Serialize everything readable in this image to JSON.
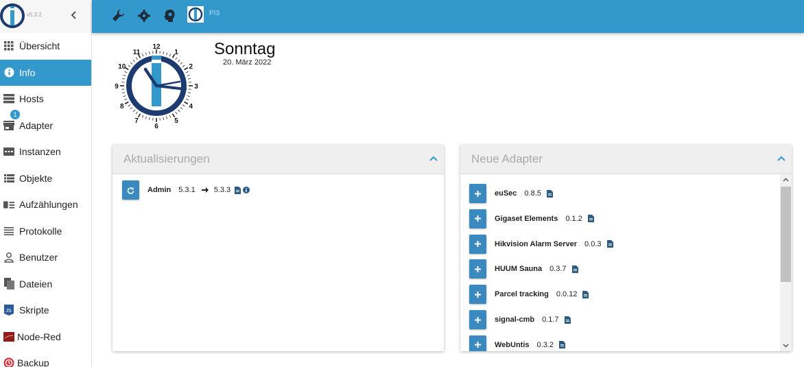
{
  "app": {
    "version": "v5.3.2",
    "host_name": "PI3"
  },
  "sidebar": {
    "items": [
      {
        "label": "Übersicht",
        "icon": "grid-icon"
      },
      {
        "label": "Info",
        "icon": "info-icon",
        "active": true
      },
      {
        "label": "Hosts",
        "icon": "hosts-icon"
      },
      {
        "label": "Adapter",
        "icon": "store-icon",
        "badge": "1"
      },
      {
        "label": "Instanzen",
        "icon": "instances-icon"
      },
      {
        "label": "Objekte",
        "icon": "list-icon"
      },
      {
        "label": "Aufzählungen",
        "icon": "enum-icon"
      },
      {
        "label": "Protokolle",
        "icon": "log-icon"
      },
      {
        "label": "Benutzer",
        "icon": "user-icon"
      },
      {
        "label": "Dateien",
        "icon": "files-icon"
      },
      {
        "label": "Skripte",
        "icon": "js-icon"
      },
      {
        "label": "Node-Red",
        "icon": "node-red-icon"
      },
      {
        "label": "Backup",
        "icon": "backup-icon"
      }
    ]
  },
  "date": {
    "weekday": "Sonntag",
    "date": "20. März 2022"
  },
  "clock": {
    "numbers": [
      "12",
      "1",
      "2",
      "3",
      "4",
      "5",
      "6",
      "7",
      "8",
      "9",
      "10",
      "11"
    ]
  },
  "updates": {
    "title": "Aktualisierungen",
    "items": [
      {
        "name": "Admin",
        "from": "5.3.1",
        "to": "5.3.3"
      }
    ]
  },
  "new_adapters": {
    "title": "Neue Adapter",
    "items": [
      {
        "name": "euSec",
        "version": "0.8.5"
      },
      {
        "name": "Gigaset Elements",
        "version": "0.1.2"
      },
      {
        "name": "Hikvision Alarm Server",
        "version": "0.0.3"
      },
      {
        "name": "HUUM Sauna",
        "version": "0.3.7"
      },
      {
        "name": "Parcel tracking",
        "version": "0.0.12"
      },
      {
        "name": "signal-cmb",
        "version": "0.1.7"
      },
      {
        "name": "WebUntis",
        "version": "0.3.2"
      }
    ]
  },
  "colors": {
    "accent": "#3399cc",
    "button": "#3a8ac0",
    "navy": "#1d3b6e"
  }
}
